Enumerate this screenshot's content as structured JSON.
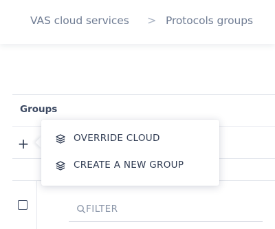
{
  "breadcrumb": {
    "items": [
      "VAS cloud services",
      "Protocols groups"
    ],
    "separator": ">"
  },
  "groups_panel": {
    "title": "Groups",
    "add_button_label": "+"
  },
  "context_menu": {
    "items": [
      {
        "label": "OVERRIDE CLOUD",
        "icon": "layers-icon"
      },
      {
        "label": "CREATE A NEW GROUP",
        "icon": "layers-icon"
      }
    ]
  },
  "filter": {
    "placeholder": "FILTER",
    "icon": "search-icon"
  },
  "colors": {
    "text_primary": "#2f3b52",
    "text_muted": "#6f7c93",
    "divider": "#e5e8ee",
    "background": "#ffffff"
  }
}
